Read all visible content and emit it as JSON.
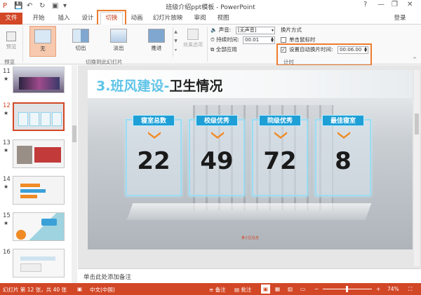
{
  "window": {
    "title": "班级介绍ppt模板 - PowerPoint",
    "help": "?",
    "minimize": "—",
    "restore": "❐",
    "close": "✕",
    "login": "登录"
  },
  "quick_access": {
    "save": "💾",
    "undo": "↶",
    "redo": "↻",
    "start": "▣",
    "customize": "▾"
  },
  "tabs": [
    {
      "label": "文件"
    },
    {
      "label": "开始"
    },
    {
      "label": "插入"
    },
    {
      "label": "设计"
    },
    {
      "label": "切换"
    },
    {
      "label": "动画"
    },
    {
      "label": "幻灯片放映"
    },
    {
      "label": "审阅"
    },
    {
      "label": "视图"
    }
  ],
  "ribbon": {
    "preview_label": "预览",
    "preview_group": "预览",
    "gallery": [
      {
        "label": "无"
      },
      {
        "label": "切出"
      },
      {
        "label": "淡出"
      },
      {
        "label": "推进"
      }
    ],
    "effect_options": "效果选项",
    "gallery_group": "切换到此幻灯片",
    "sound_label": "声音:",
    "sound_value": "[无声音]",
    "duration_label": "持续时间:",
    "duration_value": "00.01",
    "apply_all": "全部应用",
    "advance_title": "换片方式",
    "on_click": "单击鼠标时",
    "auto_after": "设置自动换片时间:",
    "auto_value": "00:06.00",
    "timing_group": "计时"
  },
  "slides": [
    {
      "num": "11",
      "star": "★"
    },
    {
      "num": "12",
      "star": "★"
    },
    {
      "num": "13",
      "star": "★"
    },
    {
      "num": "14",
      "star": "★"
    },
    {
      "num": "15",
      "star": "★"
    },
    {
      "num": "16",
      "star": ""
    }
  ],
  "current_slide": {
    "title_prefix": "3.班风建设-",
    "title_main": "卫生情况",
    "cards": [
      {
        "tag": "寝室总数",
        "value": "22"
      },
      {
        "tag": "校级优秀",
        "value": "49"
      },
      {
        "tag": "院级优秀",
        "value": "72"
      },
      {
        "tag": "最佳寝室",
        "value": "8"
      }
    ],
    "footer_note": "某小区信息"
  },
  "notes_placeholder": "单击此处添加备注",
  "status": {
    "slide_info": "幻灯片 第 12 张，共 40 张",
    "language": "中文(中国)",
    "notes": "备注",
    "comments": "批注",
    "zoom": "74%"
  },
  "colors": {
    "accent": "#d24726",
    "highlight": "#ed7d31",
    "card_tag": "#1e9fd6"
  }
}
